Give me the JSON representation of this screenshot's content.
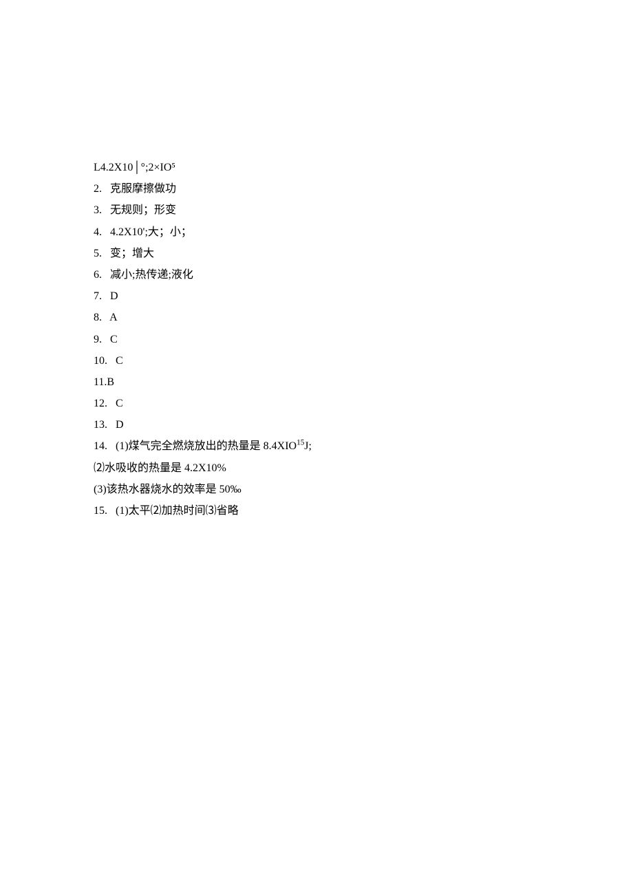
{
  "answers": {
    "l1": "L4.2X10│°;2×IO⁵",
    "l2_num": "2.",
    "l2_text": "克服摩擦做功",
    "l3_num": "3.",
    "l3_text": "无规则；形变",
    "l4_num": "4.",
    "l4_text": "4.2X10';大；小；",
    "l5_num": "5.",
    "l5_text": "变；增大",
    "l6_num": "6.",
    "l6_text": "减小;热传递;液化",
    "l7_num": "7.",
    "l7_text": "D",
    "l8_num": "8.",
    "l8_text": "A",
    "l9_num": "9.",
    "l9_text": "C",
    "l10_num": "10.",
    "l10_text": "C",
    "l11": "11.B",
    "l12_num": "12.",
    "l12_text": "C",
    "l13_num": "13.",
    "l13_text": "D",
    "l14_num": "14.",
    "l14_text_a": "(1)煤气完全燃烧放出的热量是 8.4XIO",
    "l14_sup": "15",
    "l14_text_b": "J;",
    "l14_2": "⑵水吸收的热量是 4.2X10%",
    "l14_3": "(3)该热水器烧水的效率是 50‰",
    "l15_num": "15.",
    "l15_text": "(1)太平⑵加热时间⑶省略"
  }
}
